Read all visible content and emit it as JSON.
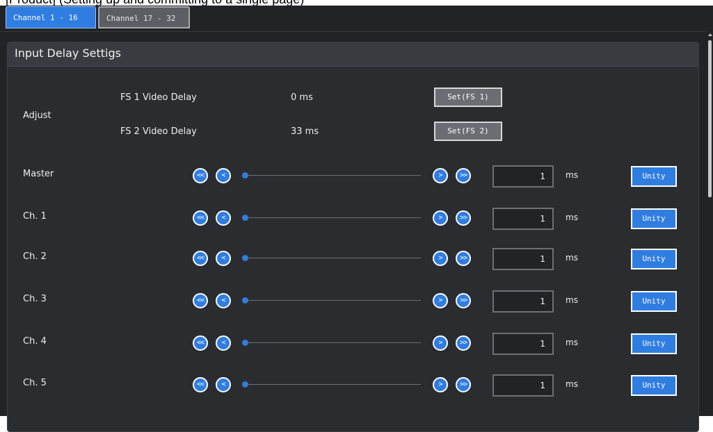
{
  "page_header_fragment": "[Product] (Setting up and committing to a single page)",
  "tabs": [
    {
      "label": "Channel 1 - 16",
      "active": true
    },
    {
      "label": "Channel 17 - 32",
      "active": false
    }
  ],
  "panel": {
    "title": "Input Delay Settigs",
    "adjust": {
      "label": "Adjust",
      "fs1": {
        "label": "FS 1 Video Delay",
        "value": "0 ms",
        "button": "Set(FS 1)"
      },
      "fs2": {
        "label": "FS 2 Video Delay",
        "value": "33 ms",
        "button": "Set(FS 2)"
      }
    },
    "rows": [
      {
        "name": "Master",
        "value": "1",
        "unit": "ms",
        "unity": "Unity",
        "btn_ll": "<<",
        "btn_l": "<",
        "btn_r": ">",
        "btn_rr": ">>"
      },
      {
        "name": "Ch. 1",
        "value": "1",
        "unit": "ms",
        "unity": "Unity",
        "btn_ll": "<<",
        "btn_l": "<",
        "btn_r": ">",
        "btn_rr": ">>"
      },
      {
        "name": "Ch. 2",
        "value": "1",
        "unit": "ms",
        "unity": "Unity",
        "btn_ll": "<<",
        "btn_l": "<",
        "btn_r": ">",
        "btn_rr": ">>"
      },
      {
        "name": "Ch. 3",
        "value": "1",
        "unit": "ms",
        "unity": "Unity",
        "btn_ll": "<<",
        "btn_l": "<",
        "btn_r": ">",
        "btn_rr": ">>"
      },
      {
        "name": "Ch. 4",
        "value": "1",
        "unit": "ms",
        "unity": "Unity",
        "btn_ll": "<<",
        "btn_l": "<",
        "btn_r": ">",
        "btn_rr": ">>"
      },
      {
        "name": "Ch. 5",
        "value": "1",
        "unit": "ms",
        "unity": "Unity",
        "btn_ll": "<<",
        "btn_l": "<",
        "btn_r": ">",
        "btn_rr": ">>"
      }
    ]
  },
  "colors": {
    "accent": "#2f7de1",
    "background": "#222326",
    "panel": "#2b2c30"
  }
}
